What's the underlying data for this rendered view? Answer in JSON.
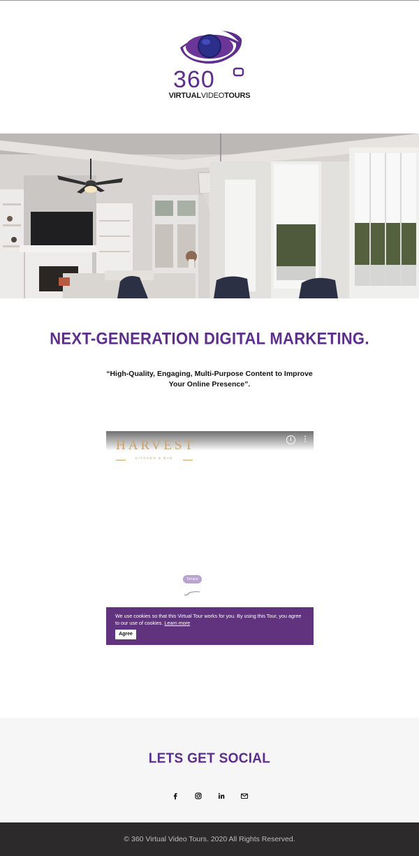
{
  "logo": {
    "number": "360",
    "word_bold_1": "VIRTUAL",
    "word_light": "VIDEO",
    "word_bold_2": "TOURS",
    "brand_color": "#5e2e8c"
  },
  "hero": {
    "image": "living-room-photo"
  },
  "headline": "NEXT-GENERATION DIGITAL MARKETING.",
  "subhead": "“High-Quality, Engaging, Multi-Purpose Content to Improve Your Online Presence”.",
  "tour": {
    "brand": "HARVEST",
    "brand_sub": "KITCHEN & BAR",
    "info_icon": "info-icon",
    "menu_icon": "more-vertical-icon",
    "pill_label": "Terrace",
    "hand_icon": "swipe-hand-icon",
    "cookie": {
      "text": "We use cookies so that this Virtual Tour works for you. By using this Tour, you agree to our use of cookies.",
      "link": "Learn more",
      "button": "Agree"
    }
  },
  "social": {
    "title": "LETS GET SOCIAL",
    "icons": [
      "facebook-icon",
      "instagram-icon",
      "linkedin-icon",
      "email-icon"
    ]
  },
  "footer": {
    "text": "© 360 Virtual Video Tours. 2020 All Rights Reserved."
  },
  "colors": {
    "accent": "#5e2e8c",
    "cookie_bg": "#61337f",
    "footer_bg": "#2c2a2a",
    "social_bg": "#f6f6f6"
  }
}
